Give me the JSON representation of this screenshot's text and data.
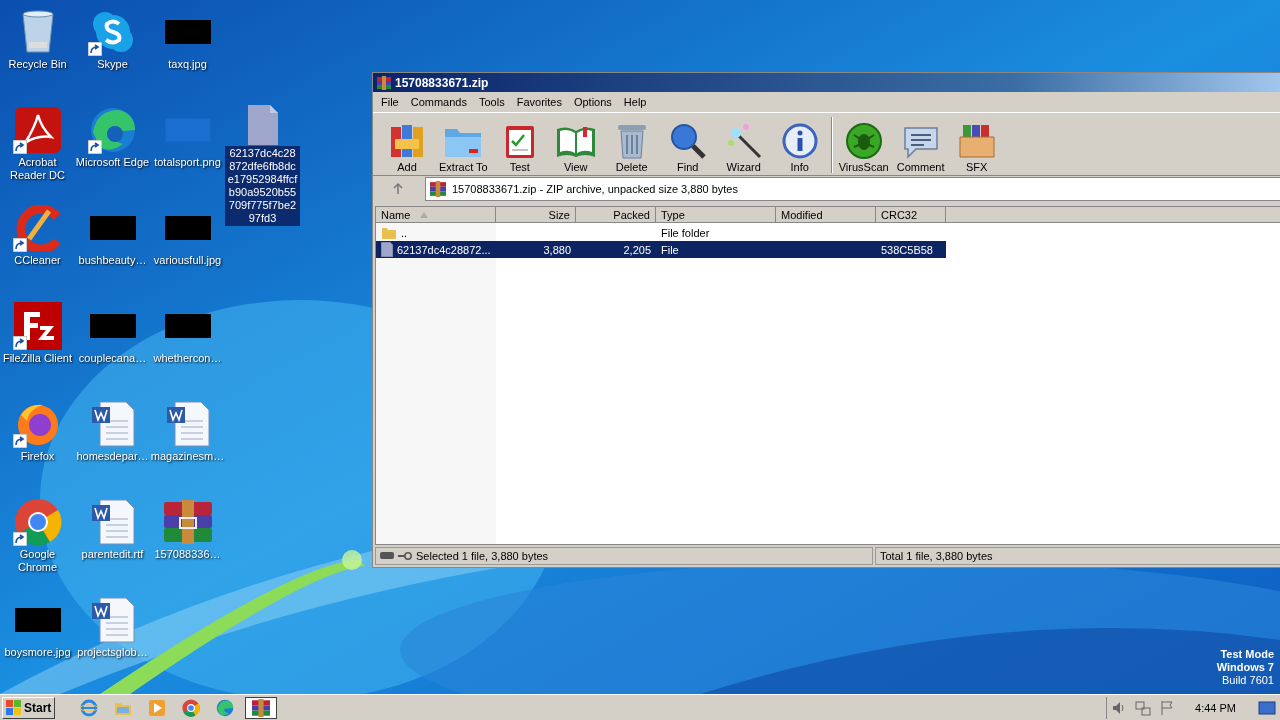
{
  "desktop": {
    "rows": [
      [
        {
          "label": "Recycle Bin",
          "kind": "recycle",
          "shortcut": false,
          "selected": false
        },
        {
          "label": "Skype",
          "kind": "skype",
          "shortcut": true,
          "selected": false
        },
        {
          "label": "taxq.jpg",
          "kind": "redacted",
          "shortcut": false,
          "selected": false
        }
      ],
      [
        {
          "label": "Acrobat Reader DC",
          "kind": "acrobat",
          "shortcut": true,
          "selected": false
        },
        {
          "label": "Microsoft Edge",
          "kind": "edge",
          "shortcut": true,
          "selected": false
        },
        {
          "label": "totalsport.png",
          "kind": "faint",
          "shortcut": false,
          "selected": false
        },
        {
          "label": "62137dc4c28872dfe6fb8dce17952984ffcfb90a9520b55709f775f7be297fd3",
          "kind": "file",
          "shortcut": false,
          "selected": true
        }
      ],
      [
        {
          "label": "CCleaner",
          "kind": "ccleaner",
          "shortcut": true,
          "selected": false
        },
        {
          "label": "bushbeauty…",
          "kind": "redacted",
          "shortcut": false,
          "selected": false
        },
        {
          "label": "variousfull.jpg",
          "kind": "redacted",
          "shortcut": false,
          "selected": false
        }
      ],
      [
        {
          "label": "FileZilla Client",
          "kind": "filezilla",
          "shortcut": true,
          "selected": false
        },
        {
          "label": "couplecana…",
          "kind": "redacted",
          "shortcut": false,
          "selected": false
        },
        {
          "label": "whethercon…",
          "kind": "redacted",
          "shortcut": false,
          "selected": false
        }
      ],
      [
        {
          "label": "Firefox",
          "kind": "firefox",
          "shortcut": true,
          "selected": false
        },
        {
          "label": "homesdepar…",
          "kind": "word",
          "shortcut": false,
          "selected": false
        },
        {
          "label": "magazinesm…",
          "kind": "word",
          "shortcut": false,
          "selected": false
        }
      ],
      [
        {
          "label": "Google Chrome",
          "kind": "chrome",
          "shortcut": true,
          "selected": false
        },
        {
          "label": "parentedit.rtf",
          "kind": "word",
          "shortcut": false,
          "selected": false
        },
        {
          "label": "157088336…",
          "kind": "winrar",
          "shortcut": false,
          "selected": false
        }
      ],
      [
        {
          "label": "boysmore.jpg",
          "kind": "redacted",
          "shortcut": false,
          "selected": false
        },
        {
          "label": "projectsglob…",
          "kind": "word",
          "shortcut": false,
          "selected": false
        }
      ]
    ]
  },
  "window": {
    "title": "15708833671.zip",
    "menu": [
      "File",
      "Commands",
      "Tools",
      "Favorites",
      "Options",
      "Help"
    ],
    "toolbar": [
      {
        "label": "Add",
        "kind": "add"
      },
      {
        "label": "Extract To",
        "kind": "extract"
      },
      {
        "label": "Test",
        "kind": "test"
      },
      {
        "label": "View",
        "kind": "view"
      },
      {
        "label": "Delete",
        "kind": "delete"
      },
      {
        "label": "Find",
        "kind": "find"
      },
      {
        "label": "Wizard",
        "kind": "wizard"
      },
      {
        "label": "Info",
        "kind": "info"
      },
      {
        "label": "VirusScan",
        "kind": "virus",
        "separator_before": true
      },
      {
        "label": "Comment",
        "kind": "comment"
      },
      {
        "label": "SFX",
        "kind": "sfx"
      }
    ],
    "path": "15708833671.zip - ZIP archive, unpacked size 3,880 bytes",
    "table": {
      "columns": [
        {
          "label": "Name",
          "sorted": true
        },
        {
          "label": "Size",
          "sorted": false
        },
        {
          "label": "Packed",
          "sorted": false
        },
        {
          "label": "Type",
          "sorted": false
        },
        {
          "label": "Modified",
          "sorted": false
        },
        {
          "label": "CRC32",
          "sorted": false
        }
      ],
      "rows": [
        {
          "kind": "folder",
          "name": "..",
          "size": "",
          "packed": "",
          "type": "File folder",
          "crc": "",
          "selected": false
        },
        {
          "kind": "file",
          "name": "62137dc4c28872...",
          "size": "3,880",
          "packed": "2,205",
          "type": "File",
          "crc": "538C5B58",
          "selected": true
        }
      ]
    },
    "status": {
      "selected": "Selected 1 file, 3,880 bytes",
      "total": "Total 1 file, 3,880 bytes"
    }
  },
  "watermark_os": [
    "Test Mode",
    "Windows 7",
    "Build 7601"
  ],
  "taskbar": {
    "start": "Start",
    "apps": [
      {
        "kind": "ie",
        "active": false
      },
      {
        "kind": "explorer",
        "active": false
      },
      {
        "kind": "media",
        "active": false
      },
      {
        "kind": "chrome",
        "active": false
      },
      {
        "kind": "edge",
        "active": false
      },
      {
        "kind": "winrar",
        "active": true
      }
    ],
    "clock": "4:44 PM"
  }
}
